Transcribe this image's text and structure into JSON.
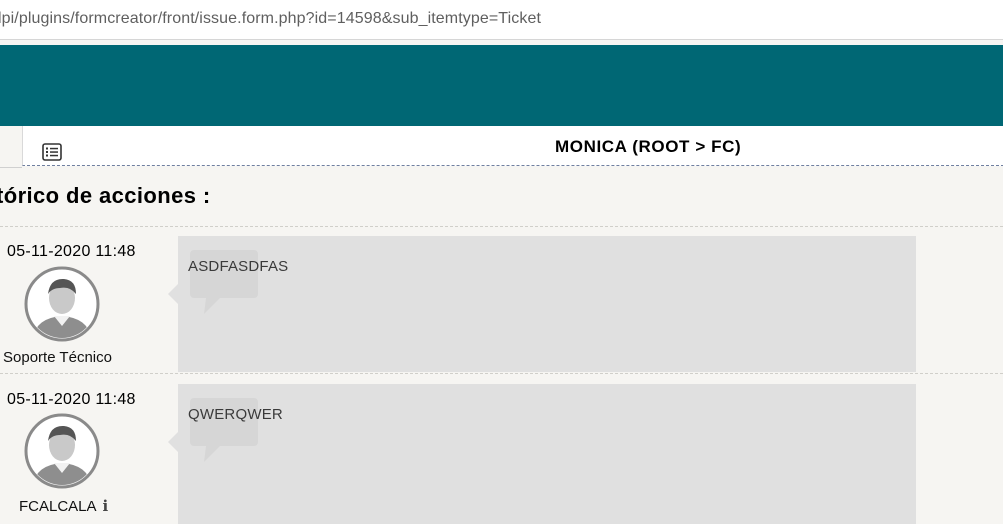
{
  "browser": {
    "url": "lpi/plugins/formcreator/front/issue.form.php?id=14598&sub_itemtype=Ticket"
  },
  "header": {
    "list_icon": "list-icon",
    "entity_title": "MONICA (ROOT > FC)"
  },
  "history": {
    "title": "tórico de acciones :",
    "entries": [
      {
        "date": "05-11-2020 11:48",
        "author": "Soporte Técnico",
        "has_info_icon": false,
        "content": "ASDFASDFAS",
        "icon": "user-avatar-icon"
      },
      {
        "date": "05-11-2020 11:48",
        "author": "FCALCALA",
        "has_info_icon": true,
        "info_icon": "info-icon",
        "content": "QWERQWER",
        "icon": "user-avatar-icon"
      }
    ]
  },
  "colors": {
    "banner": "#006774",
    "page_background": "#f6f5f2",
    "bubble": "#e0e0e0"
  }
}
